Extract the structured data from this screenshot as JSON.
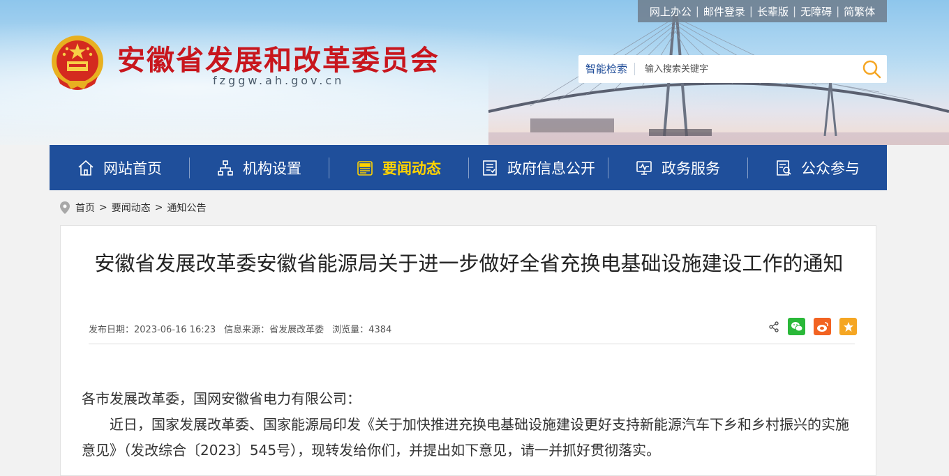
{
  "header": {
    "site_title": "安徽省发展和改革委员会",
    "site_domain": "fzggw.ah.gov.cn",
    "top_links": [
      "网上办公",
      "邮件登录",
      "长辈版",
      "无障碍",
      "简繁体"
    ]
  },
  "search": {
    "label": "智能检索",
    "placeholder": "输入搜索关键字",
    "icon": "search-icon"
  },
  "nav": {
    "items": [
      {
        "label": "网站首页",
        "icon": "home-icon"
      },
      {
        "label": "机构设置",
        "icon": "org-chart-icon"
      },
      {
        "label": "要闻动态",
        "icon": "news-icon",
        "active": true
      },
      {
        "label": "政府信息公开",
        "icon": "document-icon"
      },
      {
        "label": "政务服务",
        "icon": "monitor-icon"
      },
      {
        "label": "公众参与",
        "icon": "participation-icon"
      }
    ],
    "background": "#1f4f9b",
    "active_color": "#ffd200"
  },
  "breadcrumb": {
    "items": [
      "首页",
      "要闻动态",
      "通知公告"
    ],
    "separator": ">"
  },
  "article": {
    "title": "安徽省发展改革委安徽省能源局关于进一步做好全省充换电基础设施建设工作的通知",
    "meta": {
      "published": "发布日期：2023-06-16 16:23",
      "source": "信息来源：省发展改革委",
      "views": "浏览量：4384"
    },
    "share_icons": [
      "share-icon",
      "wechat-icon",
      "weibo-icon",
      "favorite-icon"
    ],
    "paragraphs": [
      "各市发展改革委，国网安徽省电力有限公司：",
      "近日，国家发展改革委、国家能源局印发《关于加快推进充换电基础设施建设更好支持新能源汽车下乡和乡村振兴的实施意见》（发改综合〔2023〕545号），现转发给你们，并提出如下意见，请一并抓好贯彻落实。"
    ]
  },
  "colors": {
    "title_red": "#c8161d",
    "wechat_green": "#2ab839",
    "weibo_orange": "#f26322",
    "favorite_orange": "#f5a623"
  }
}
